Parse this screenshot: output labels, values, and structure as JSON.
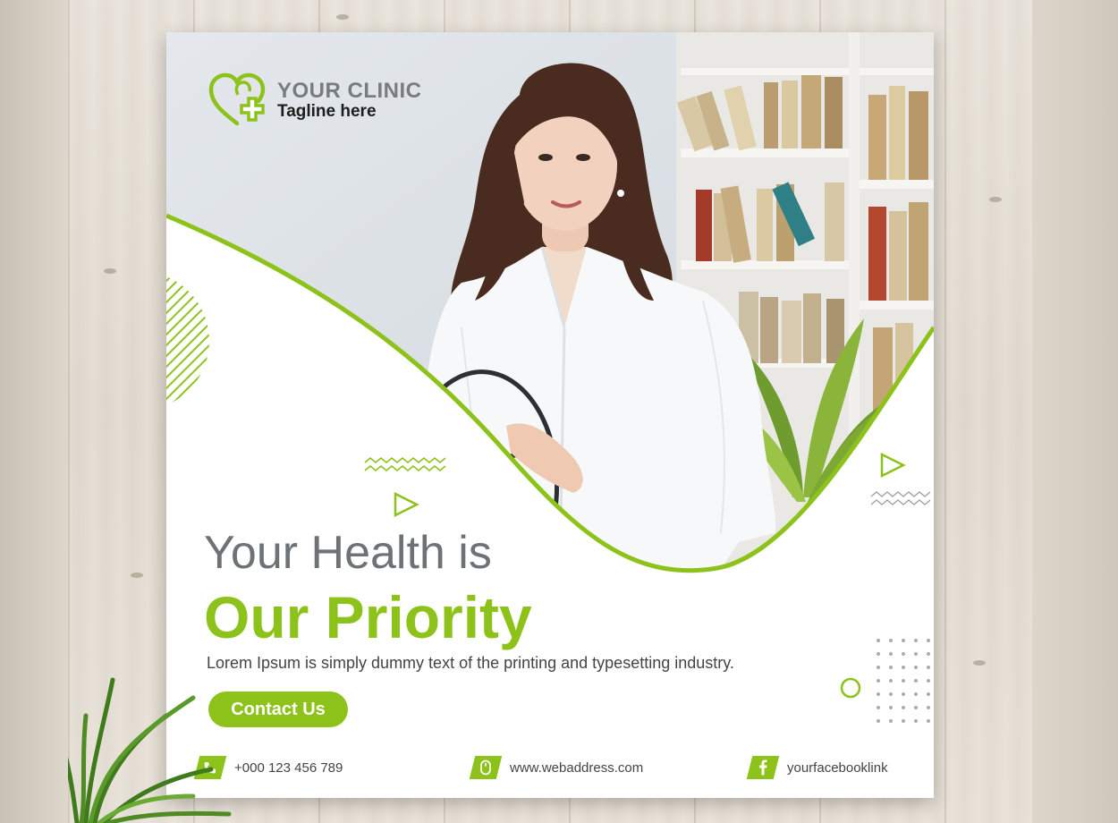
{
  "clinic": {
    "name": "YOUR CLINIC",
    "tagline": "Tagline here"
  },
  "headline": {
    "line1": "Your Health is",
    "line2": "Our Priority"
  },
  "body_text": "Lorem Ipsum is simply dummy text of the printing and typesetting industry.",
  "cta_label": "Contact Us",
  "contacts": {
    "phone": "+000 123 456 789",
    "web": "www.webaddress.com",
    "facebook": "yourfacebooklink"
  },
  "colors": {
    "accent": "#8cc21a",
    "headline_gray": "#6d7277",
    "wood": "#e6e0d7"
  },
  "icons": [
    "clinic-logo-icon",
    "phone-icon",
    "mouse-icon",
    "facebook-icon"
  ]
}
